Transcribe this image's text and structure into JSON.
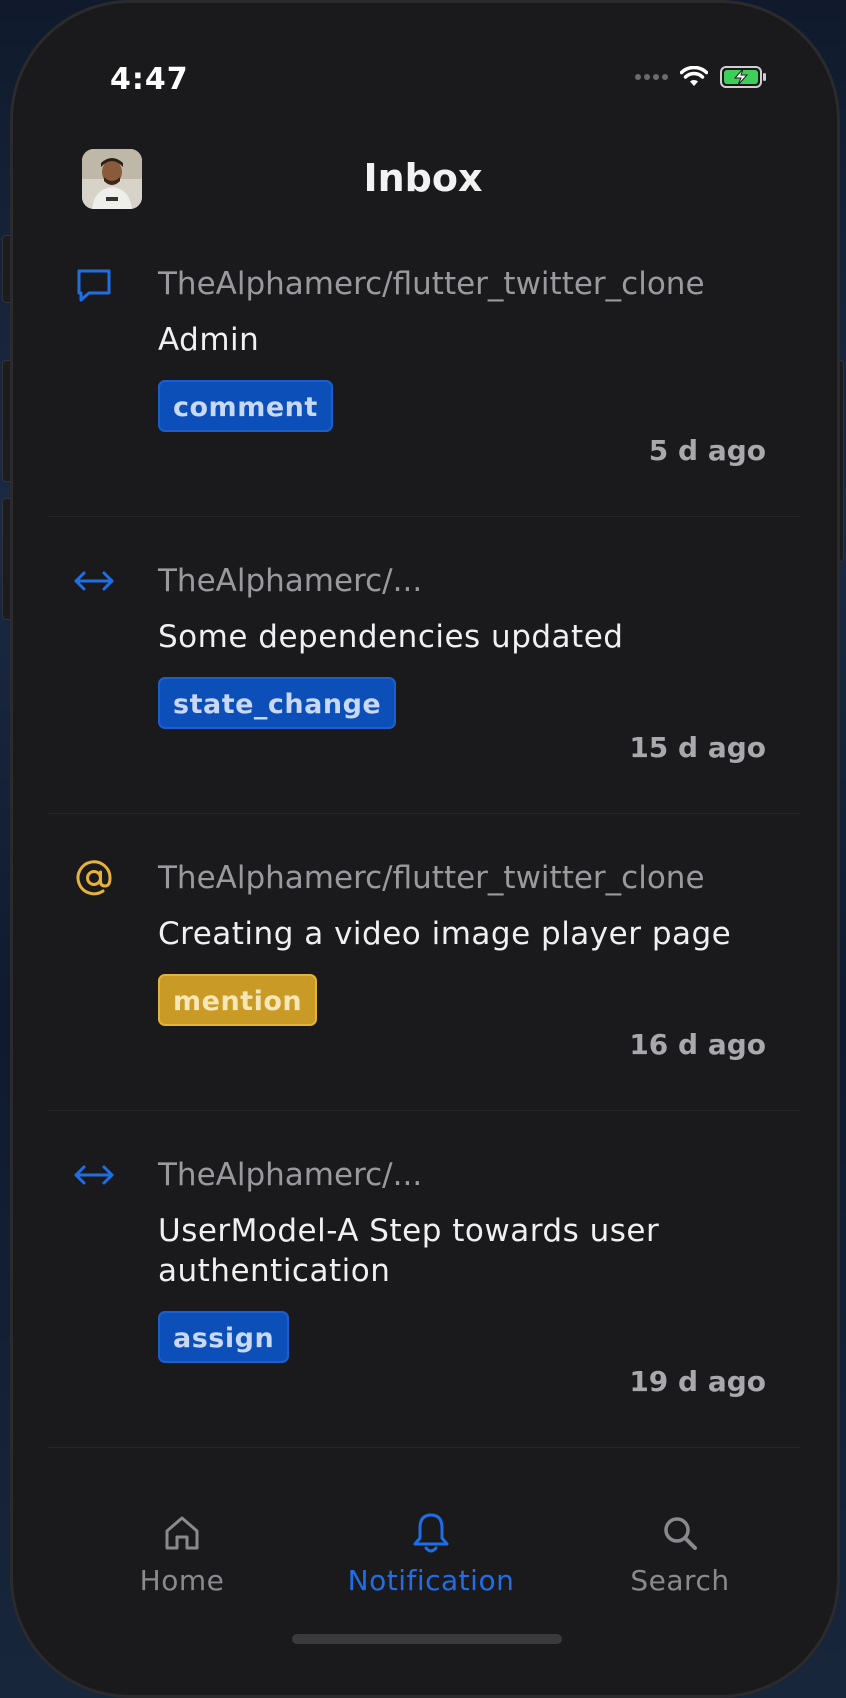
{
  "status_bar": {
    "time": "4:47"
  },
  "header": {
    "title": "Inbox"
  },
  "notifications": [
    {
      "icon": "comment-icon",
      "icon_color": "#1f6ee6",
      "repo": "TheAlphamerc/flutter_twitter_clone",
      "title": "Admin",
      "tag": "comment",
      "tag_style": "blue",
      "time": "5 d ago"
    },
    {
      "icon": "state-change-icon",
      "icon_color": "#1f6ee6",
      "repo": "TheAlphamerc/...",
      "title": "Some dependencies updated",
      "tag": "state_change",
      "tag_style": "blue",
      "time": "15 d ago"
    },
    {
      "icon": "mention-icon",
      "icon_color": "#e7b23a",
      "repo": "TheAlphamerc/flutter_twitter_clone",
      "title": "Creating a video image player page",
      "tag": "mention",
      "tag_style": "yellow",
      "time": "16 d ago"
    },
    {
      "icon": "state-change-icon",
      "icon_color": "#1f6ee6",
      "repo": "TheAlphamerc/...",
      "title": "UserModel-A Step towards user authentication",
      "tag": "assign",
      "tag_style": "blue",
      "time": "19 d ago"
    }
  ],
  "bottom_nav": {
    "items": [
      {
        "label": "Home",
        "icon": "home-icon",
        "active": false
      },
      {
        "label": "Notification",
        "icon": "bell-icon",
        "active": true
      },
      {
        "label": "Search",
        "icon": "search-icon",
        "active": false
      }
    ],
    "active_color": "#1f6ee6",
    "inactive_color": "#8a8a8e"
  }
}
